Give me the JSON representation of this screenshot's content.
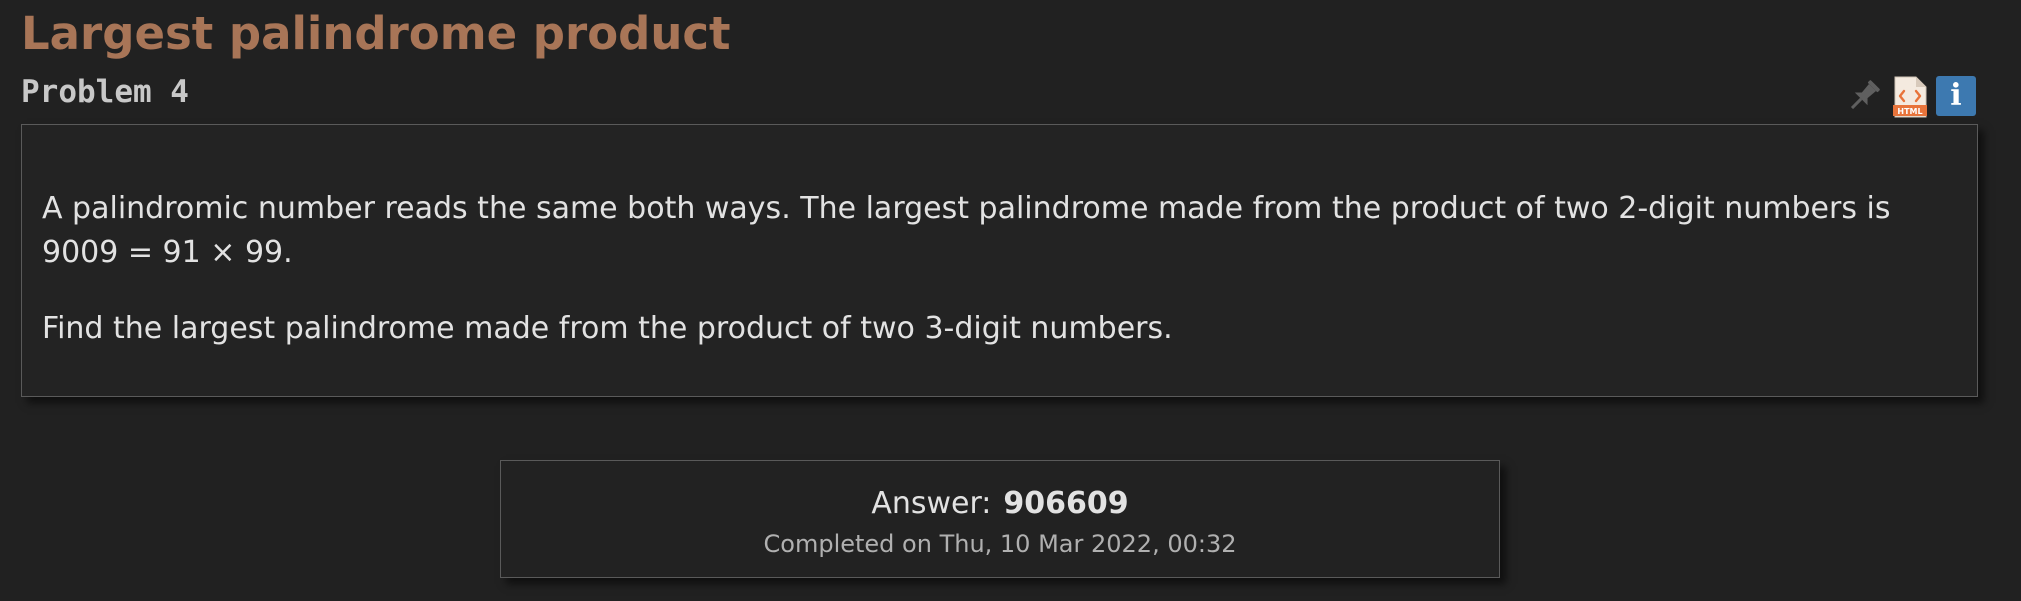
{
  "problem": {
    "title": "Largest palindrome product",
    "number_label": "Problem 4",
    "paragraphs": [
      "A palindromic number reads the same both ways. The largest palindrome made from the product of two 2-digit numbers is 9009 = 91 × 99.",
      "Find the largest palindrome made from the product of two 3-digit numbers."
    ]
  },
  "toolbar": {
    "icons": [
      "pin-icon",
      "html-icon",
      "info-icon"
    ],
    "html_badge": "HTML",
    "info_glyph": "i"
  },
  "answer": {
    "label": "Answer:",
    "value": "906609",
    "completed": "Completed on Thu, 10 Mar 2022, 00:32"
  },
  "colors": {
    "background": "#212121",
    "title": "#a87557",
    "info_icon": "#3d79b0",
    "html_icon": "#e8743b"
  }
}
